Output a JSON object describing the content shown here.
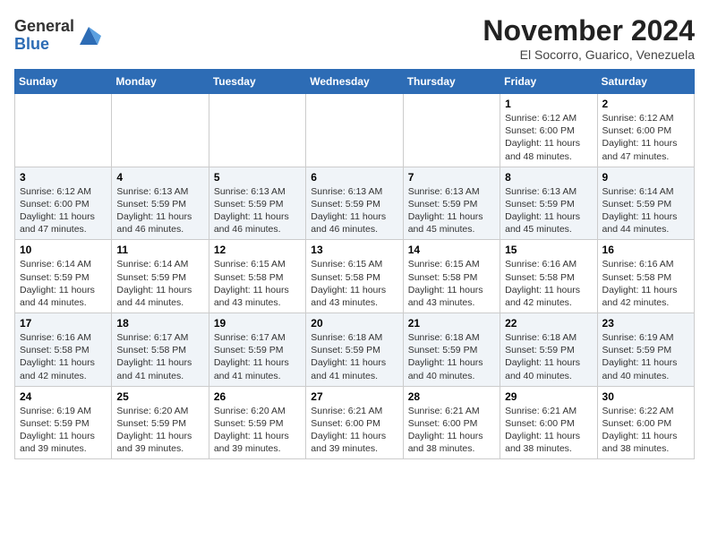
{
  "logo": {
    "general": "General",
    "blue": "Blue",
    "aria": "GeneralBlue logo"
  },
  "header": {
    "month": "November 2024",
    "location": "El Socorro, Guarico, Venezuela"
  },
  "weekdays": [
    "Sunday",
    "Monday",
    "Tuesday",
    "Wednesday",
    "Thursday",
    "Friday",
    "Saturday"
  ],
  "weeks": [
    [
      {
        "day": "",
        "info": ""
      },
      {
        "day": "",
        "info": ""
      },
      {
        "day": "",
        "info": ""
      },
      {
        "day": "",
        "info": ""
      },
      {
        "day": "",
        "info": ""
      },
      {
        "day": "1",
        "info": "Sunrise: 6:12 AM\nSunset: 6:00 PM\nDaylight: 11 hours and 48 minutes."
      },
      {
        "day": "2",
        "info": "Sunrise: 6:12 AM\nSunset: 6:00 PM\nDaylight: 11 hours and 47 minutes."
      }
    ],
    [
      {
        "day": "3",
        "info": "Sunrise: 6:12 AM\nSunset: 6:00 PM\nDaylight: 11 hours and 47 minutes."
      },
      {
        "day": "4",
        "info": "Sunrise: 6:13 AM\nSunset: 5:59 PM\nDaylight: 11 hours and 46 minutes."
      },
      {
        "day": "5",
        "info": "Sunrise: 6:13 AM\nSunset: 5:59 PM\nDaylight: 11 hours and 46 minutes."
      },
      {
        "day": "6",
        "info": "Sunrise: 6:13 AM\nSunset: 5:59 PM\nDaylight: 11 hours and 46 minutes."
      },
      {
        "day": "7",
        "info": "Sunrise: 6:13 AM\nSunset: 5:59 PM\nDaylight: 11 hours and 45 minutes."
      },
      {
        "day": "8",
        "info": "Sunrise: 6:13 AM\nSunset: 5:59 PM\nDaylight: 11 hours and 45 minutes."
      },
      {
        "day": "9",
        "info": "Sunrise: 6:14 AM\nSunset: 5:59 PM\nDaylight: 11 hours and 44 minutes."
      }
    ],
    [
      {
        "day": "10",
        "info": "Sunrise: 6:14 AM\nSunset: 5:59 PM\nDaylight: 11 hours and 44 minutes."
      },
      {
        "day": "11",
        "info": "Sunrise: 6:14 AM\nSunset: 5:59 PM\nDaylight: 11 hours and 44 minutes."
      },
      {
        "day": "12",
        "info": "Sunrise: 6:15 AM\nSunset: 5:58 PM\nDaylight: 11 hours and 43 minutes."
      },
      {
        "day": "13",
        "info": "Sunrise: 6:15 AM\nSunset: 5:58 PM\nDaylight: 11 hours and 43 minutes."
      },
      {
        "day": "14",
        "info": "Sunrise: 6:15 AM\nSunset: 5:58 PM\nDaylight: 11 hours and 43 minutes."
      },
      {
        "day": "15",
        "info": "Sunrise: 6:16 AM\nSunset: 5:58 PM\nDaylight: 11 hours and 42 minutes."
      },
      {
        "day": "16",
        "info": "Sunrise: 6:16 AM\nSunset: 5:58 PM\nDaylight: 11 hours and 42 minutes."
      }
    ],
    [
      {
        "day": "17",
        "info": "Sunrise: 6:16 AM\nSunset: 5:58 PM\nDaylight: 11 hours and 42 minutes."
      },
      {
        "day": "18",
        "info": "Sunrise: 6:17 AM\nSunset: 5:58 PM\nDaylight: 11 hours and 41 minutes."
      },
      {
        "day": "19",
        "info": "Sunrise: 6:17 AM\nSunset: 5:59 PM\nDaylight: 11 hours and 41 minutes."
      },
      {
        "day": "20",
        "info": "Sunrise: 6:18 AM\nSunset: 5:59 PM\nDaylight: 11 hours and 41 minutes."
      },
      {
        "day": "21",
        "info": "Sunrise: 6:18 AM\nSunset: 5:59 PM\nDaylight: 11 hours and 40 minutes."
      },
      {
        "day": "22",
        "info": "Sunrise: 6:18 AM\nSunset: 5:59 PM\nDaylight: 11 hours and 40 minutes."
      },
      {
        "day": "23",
        "info": "Sunrise: 6:19 AM\nSunset: 5:59 PM\nDaylight: 11 hours and 40 minutes."
      }
    ],
    [
      {
        "day": "24",
        "info": "Sunrise: 6:19 AM\nSunset: 5:59 PM\nDaylight: 11 hours and 39 minutes."
      },
      {
        "day": "25",
        "info": "Sunrise: 6:20 AM\nSunset: 5:59 PM\nDaylight: 11 hours and 39 minutes."
      },
      {
        "day": "26",
        "info": "Sunrise: 6:20 AM\nSunset: 5:59 PM\nDaylight: 11 hours and 39 minutes."
      },
      {
        "day": "27",
        "info": "Sunrise: 6:21 AM\nSunset: 6:00 PM\nDaylight: 11 hours and 39 minutes."
      },
      {
        "day": "28",
        "info": "Sunrise: 6:21 AM\nSunset: 6:00 PM\nDaylight: 11 hours and 38 minutes."
      },
      {
        "day": "29",
        "info": "Sunrise: 6:21 AM\nSunset: 6:00 PM\nDaylight: 11 hours and 38 minutes."
      },
      {
        "day": "30",
        "info": "Sunrise: 6:22 AM\nSunset: 6:00 PM\nDaylight: 11 hours and 38 minutes."
      }
    ]
  ]
}
